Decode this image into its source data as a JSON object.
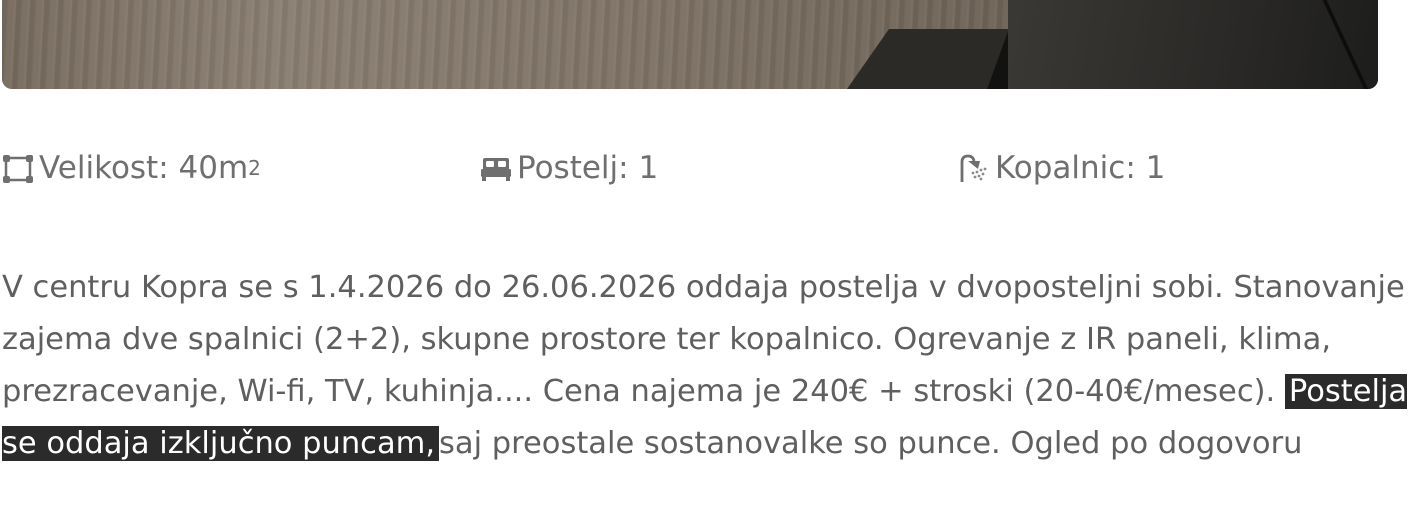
{
  "photo": {
    "alt_colors": {
      "floor": "#7f7366",
      "wall": "#2a2927"
    }
  },
  "features": [
    {
      "icon": "area-icon",
      "label": "Velikost: 40m",
      "superscript": "2"
    },
    {
      "icon": "bed-icon",
      "label": "Postelj: 1"
    },
    {
      "icon": "shower-icon",
      "label": "Kopalnic: 1"
    }
  ],
  "description": {
    "part1": "V centru Kopra se s 1.4.2026 do 26.06.2026 oddaja postelja v dvoposteljni sobi. Stanovanje zajema dve spalnici (2+2), skupne prostore ter kopalnico. Ogrevanje z IR paneli, klima, prezracevanje, Wi-fi, TV, kuhinja.... Cena najema je 240€ + stroski (20-40€/mesec).",
    "highlight": "Postelja se oddaja izključno puncam,",
    "part2": "saj preostale sostanovalke so punce. Ogled po dogovoru"
  },
  "colors": {
    "text": "#5f5f5f",
    "icon": "#6f6f6f",
    "highlight_bg": "#2b2b2b",
    "highlight_text": "#ffffff"
  }
}
